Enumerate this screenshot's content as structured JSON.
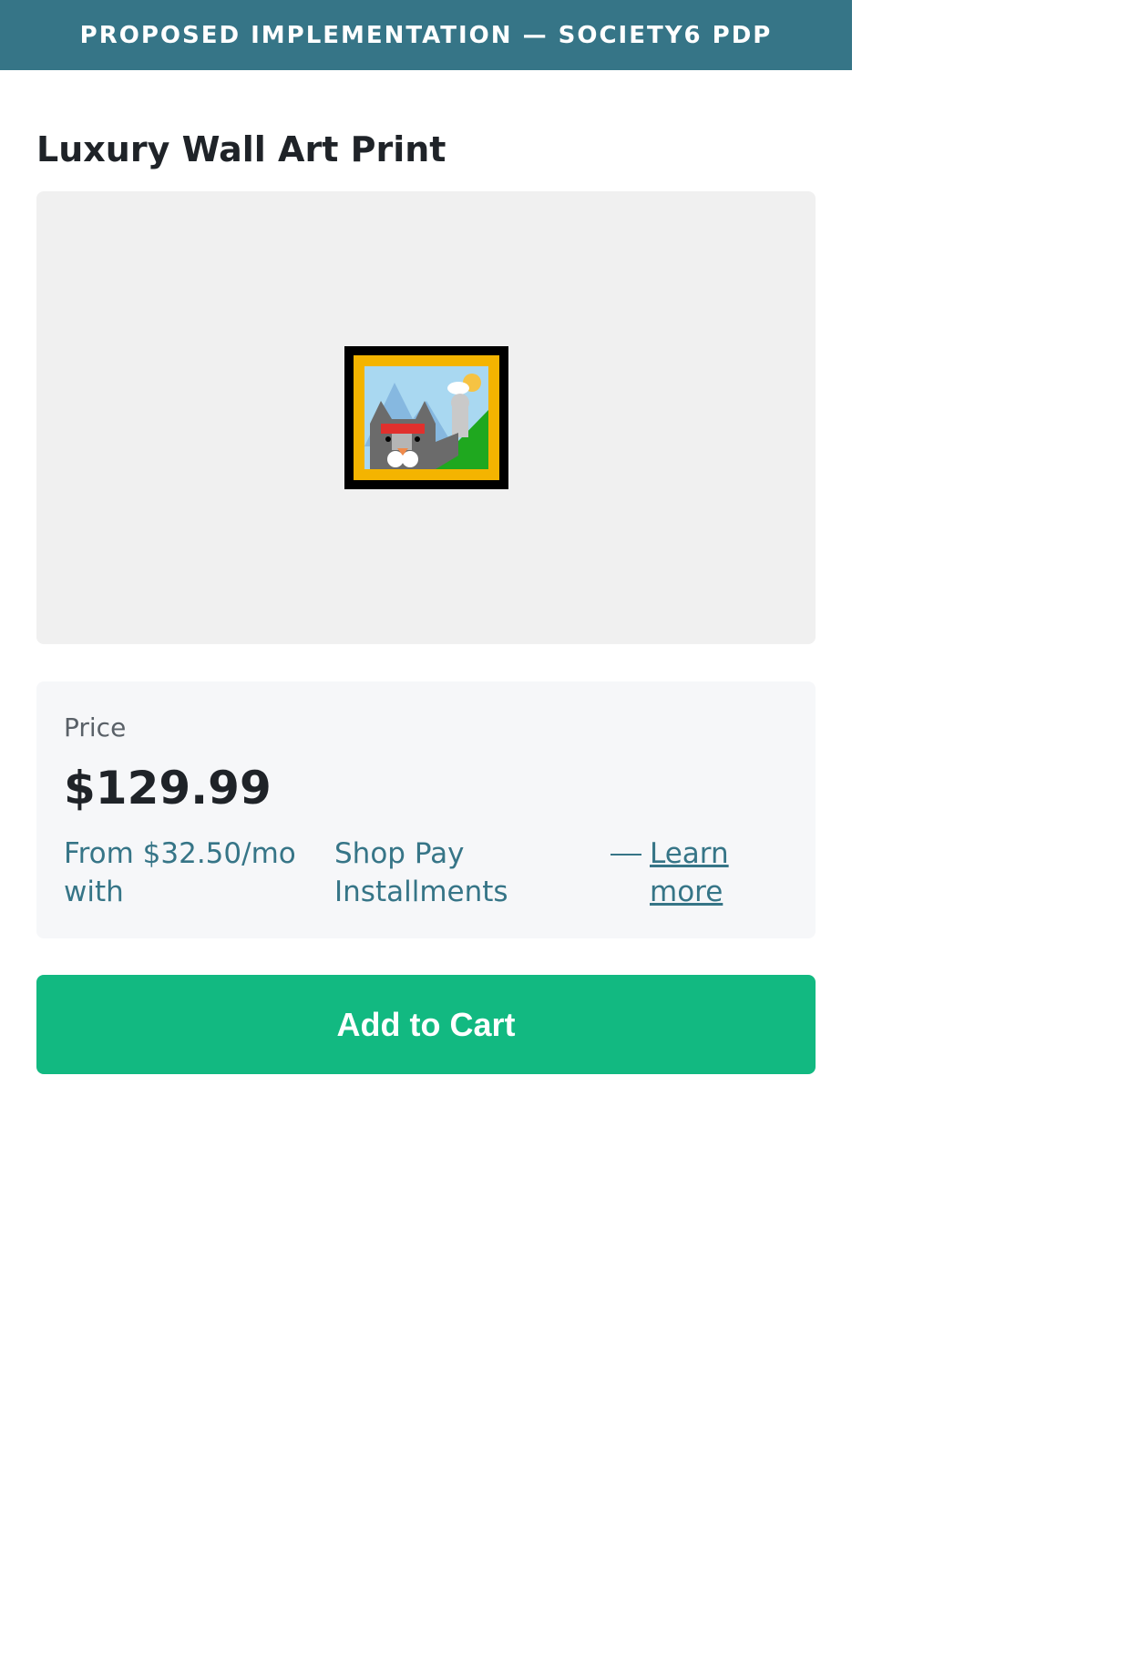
{
  "banner": {
    "text": "PROPOSED IMPLEMENTATION — SOCIETY6 PDP"
  },
  "product": {
    "title": "Luxury Wall Art Print",
    "image_icon": "framed-picture-icon"
  },
  "pricing": {
    "label": "Price",
    "value": "$129.99",
    "installments_from": "From $32.50/mo with",
    "installments_provider": "Shop Pay Installments",
    "learn_more": "Learn more"
  },
  "actions": {
    "add_to_cart": "Add to Cart"
  },
  "colors": {
    "banner_bg": "#367587",
    "accent_link": "#367587",
    "cart_button_bg": "#12b981",
    "image_bg": "#f0f0f0",
    "price_box_bg": "#f6f7f9"
  }
}
